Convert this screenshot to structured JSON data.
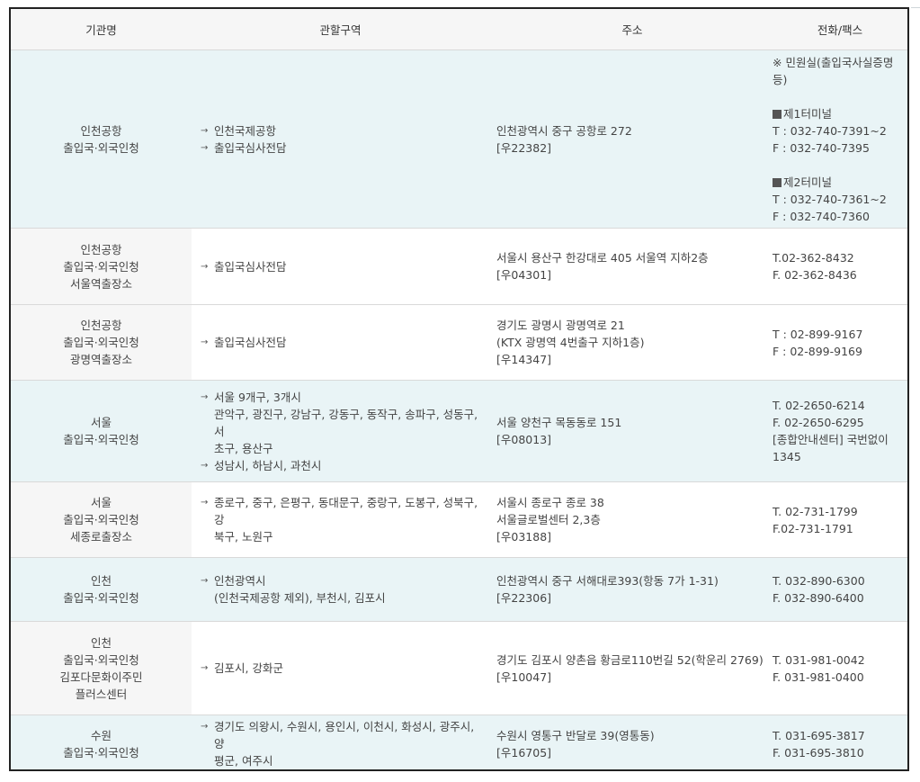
{
  "headers": {
    "org": "기관명",
    "area": "관할구역",
    "addr": "주소",
    "tel": "전화/팩스"
  },
  "rows": [
    {
      "org": [
        "인천공항",
        "출입국·외국인청"
      ],
      "area": [
        [
          "인천국제공항"
        ],
        [
          "출입국심사전담"
        ]
      ],
      "addr": [
        "인천광역시 중구 공항로 272",
        "[우22382]"
      ],
      "tel": {
        "note": "※ 민원실(출입국사실증명 등)",
        "t1_title": "제1터미널",
        "t1_tel": "T : 032-740-7391~2",
        "t1_fax": "F : 032-740-7395",
        "t2_title": "제2터미널",
        "t2_tel": "T : 032-740-7361~2",
        "t2_fax": "F : 032-740-7360"
      }
    },
    {
      "org": [
        "인천공항",
        "출입국·외국인청",
        "서울역출장소"
      ],
      "area": [
        [
          "출입국심사전담"
        ]
      ],
      "addr": [
        "서울시 용산구 한강대로 405 서울역 지하2층",
        "[우04301]"
      ],
      "tel": [
        "T.02-362-8432",
        "F. 02-362-8436"
      ]
    },
    {
      "org": [
        "인천공항",
        "출입국·외국인청",
        "광명역출장소"
      ],
      "area": [
        [
          "출입국심사전담"
        ]
      ],
      "addr": [
        "경기도 광명시 광명역로 21",
        "(KTX 광명역 4번출구 지하1층)",
        "[우14347]"
      ],
      "tel": [
        "T : 02-899-9167",
        "F : 02-899-9169"
      ]
    },
    {
      "org": [
        "서울",
        "출입국·외국인청"
      ],
      "area": [
        [
          "서울 9개구, 3개시",
          "관악구, 광진구, 강남구, 강동구, 동작구, 송파구, 성동구, 서",
          "초구, 용산구"
        ],
        [
          "성남시, 하남시, 과천시"
        ]
      ],
      "addr": [
        "서울 양천구 목동동로 151",
        "[우08013]"
      ],
      "tel": [
        "T. 02-2650-6214",
        "F. 02-2650-6295",
        "[종합안내센터] 국번없이 1345"
      ]
    },
    {
      "org": [
        "서울",
        "출입국·외국인청",
        "세종로출장소"
      ],
      "area": [
        [
          "종로구, 중구, 은평구, 동대문구, 중랑구, 도봉구, 성북구, 강",
          "북구, 노원구"
        ]
      ],
      "addr": [
        "서울시 종로구 종로 38",
        "서울글로벌센터 2,3층",
        "[우03188]"
      ],
      "tel": [
        "T. 02-731-1799",
        "F.02-731-1791"
      ]
    },
    {
      "org": [
        "인천",
        "출입국·외국인청"
      ],
      "area": [
        [
          "인천광역시",
          "(인천국제공항 제외), 부천시, 김포시"
        ]
      ],
      "addr": [
        "인천광역시 중구 서해대로393(항동 7가 1-31)",
        "[우22306]"
      ],
      "tel": [
        "T. 032-890-6300",
        "F. 032-890-6400"
      ]
    },
    {
      "org": [
        "인천",
        "출입국·외국인청",
        "김포다문화이주민",
        "플러스센터"
      ],
      "area": [
        [
          "김포시, 강화군"
        ]
      ],
      "addr": [
        "경기도 김포시 양촌읍 황금로110번길 52(학운리 2769)",
        "[우10047]"
      ],
      "tel": [
        "T. 031-981-0042",
        "F. 031-981-0400"
      ]
    },
    {
      "org": [
        "수원",
        "출입국·외국인청"
      ],
      "area": [
        [
          "경기도 의왕시, 수원시, 용인시, 이천시, 화성시, 광주시, 양",
          "평군, 여주시"
        ]
      ],
      "addr": [
        "수원시 영통구 반달로 39(영통동)",
        "[우16705]"
      ],
      "tel": [
        "T. 031-695-3817",
        "F. 031-695-3810"
      ]
    }
  ],
  "row_styles": [
    "blue",
    "white",
    "white",
    "blue",
    "white",
    "blue",
    "white",
    "blue"
  ],
  "colors": {
    "header_bg": "#f6f6f6",
    "blue_row": "#e9f4f6",
    "border": "#d9d9d9",
    "frame": "#222222"
  }
}
